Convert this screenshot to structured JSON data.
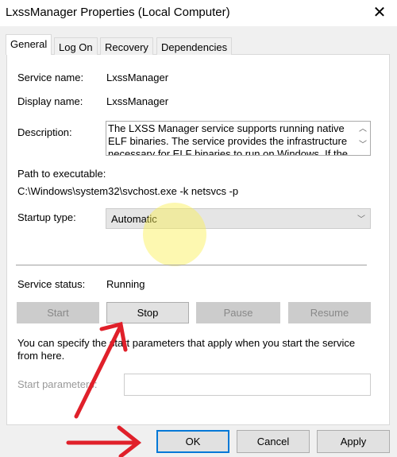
{
  "window": {
    "title": "LxssManager Properties (Local Computer)",
    "close_icon": "close-icon"
  },
  "tabs": [
    {
      "label": "General",
      "active": true
    },
    {
      "label": "Log On"
    },
    {
      "label": "Recovery"
    },
    {
      "label": "Dependencies"
    }
  ],
  "general": {
    "service_name_label": "Service name:",
    "service_name": "LxssManager",
    "display_name_label": "Display name:",
    "display_name": "LxssManager",
    "description_label": "Description:",
    "description": "The LXSS Manager service supports running native ELF binaries. The service provides the infrastructure necessary for ELF binaries to run on Windows. If the",
    "path_label": "Path to executable:",
    "path": "C:\\Windows\\system32\\svchost.exe -k netsvcs -p",
    "startup_type_label": "Startup type:",
    "startup_type": "Automatic",
    "service_status_label": "Service status:",
    "service_status": "Running",
    "buttons": {
      "start": "Start",
      "stop": "Stop",
      "pause": "Pause",
      "resume": "Resume"
    },
    "hint": "You can specify the start parameters that apply when you start the service from here.",
    "start_params_label": "Start parameters:",
    "start_params_value": ""
  },
  "footer": {
    "ok": "OK",
    "cancel": "Cancel",
    "apply": "Apply"
  },
  "annotation_color": "#e0202a"
}
